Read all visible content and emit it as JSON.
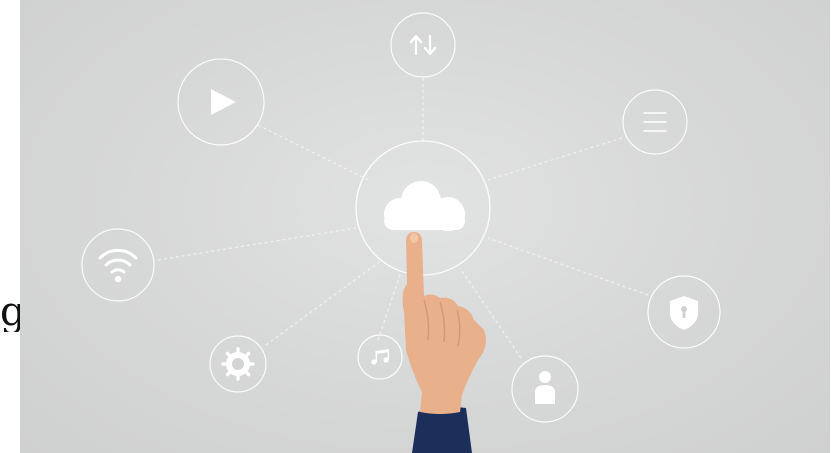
{
  "side_glyph": "g",
  "colors": {
    "background": "#d6d7d7",
    "icon": "#ffffff",
    "line": "#f4f4f4",
    "skin": "#e9b08c",
    "sleeve": "#1c2e5a"
  },
  "icons": [
    "cloud-icon",
    "transfer-arrows-icon",
    "play-icon",
    "menu-icon",
    "wifi-icon",
    "shield-lock-icon",
    "settings-gear-icon",
    "music-note-icon",
    "user-icon"
  ]
}
